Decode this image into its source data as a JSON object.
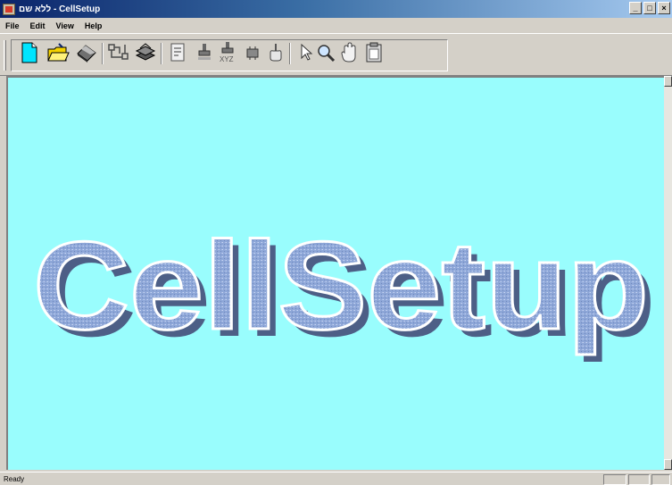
{
  "window": {
    "title": "ללא שם - CellSetup",
    "controls": {
      "minimize": "_",
      "maximize": "□",
      "close": "×"
    }
  },
  "menu": [
    {
      "label": "File"
    },
    {
      "label": "Edit"
    },
    {
      "label": "View"
    },
    {
      "label": "Help"
    }
  ],
  "toolbar": {
    "buttons": [
      {
        "icon": "new-document-icon"
      },
      {
        "icon": "open-folder-icon"
      },
      {
        "icon": "eraser-icon"
      },
      {
        "icon": "schematic-icon"
      },
      {
        "icon": "layers-icon"
      },
      {
        "icon": "properties-icon"
      },
      {
        "icon": "stamp-icon"
      },
      {
        "icon": "stamp-xyz-icon"
      },
      {
        "icon": "component-icon"
      },
      {
        "icon": "grab-icon"
      },
      {
        "icon": "pointer-icon"
      },
      {
        "icon": "zoom-icon"
      },
      {
        "icon": "pan-hand-icon"
      },
      {
        "icon": "clipboard-icon"
      }
    ]
  },
  "document": {
    "splash_text": "CellSetup",
    "background": "#99fdfd",
    "text_color": "#8aa6d6"
  },
  "status": {
    "text": "Ready"
  }
}
